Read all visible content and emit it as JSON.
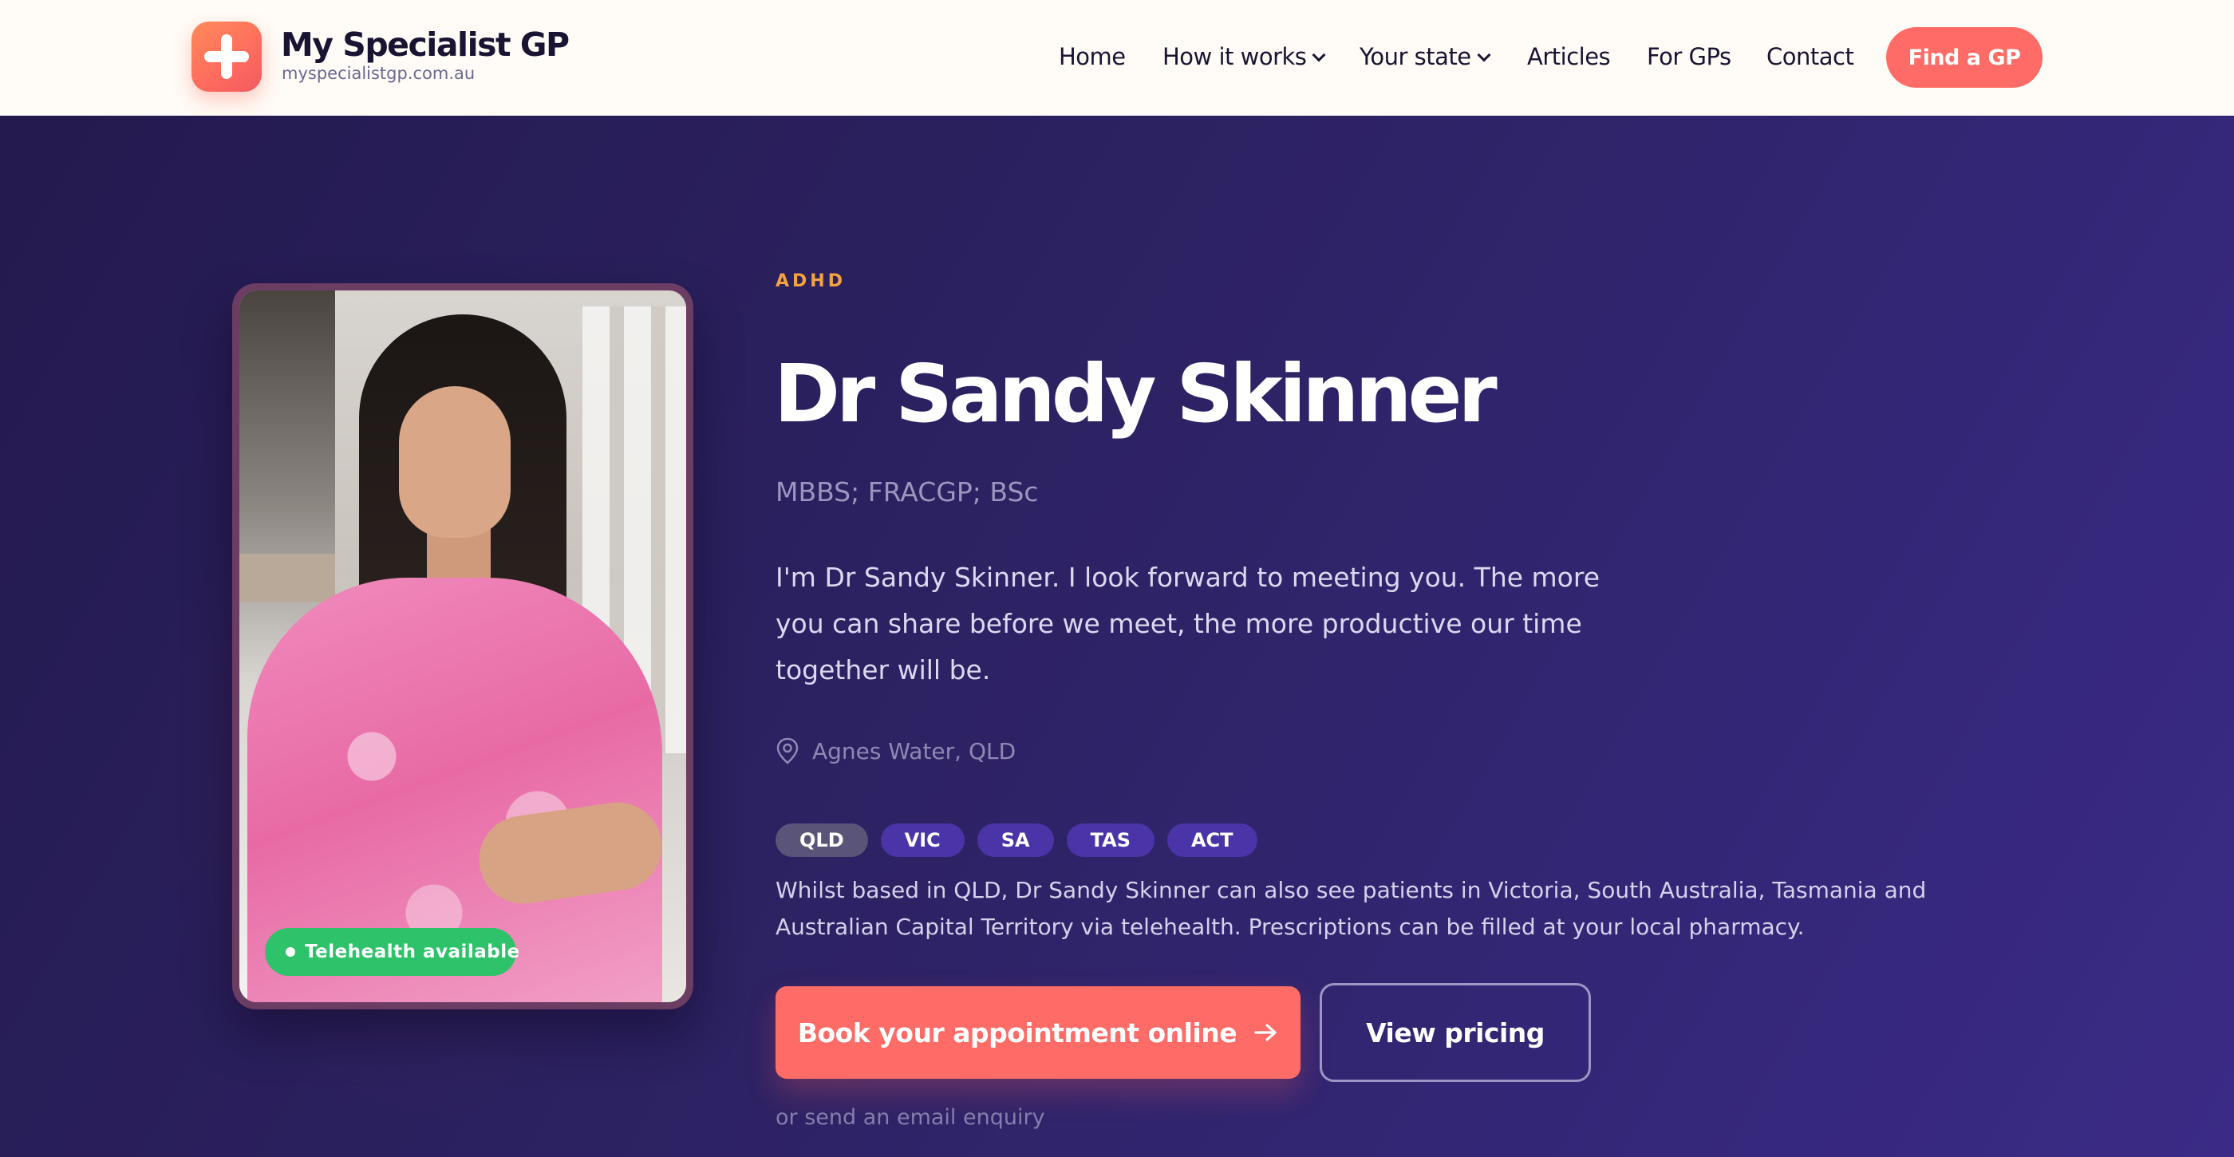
{
  "header": {
    "logo_title": "My Specialist GP",
    "logo_subtitle": "myspecialistgp.com.au",
    "logo_icon": "plus-cross-icon",
    "nav": {
      "home": "Home",
      "how_it_works": "How it works",
      "your_state": "Your state",
      "articles": "Articles",
      "for_gps": "For GPs",
      "contact": "Contact"
    },
    "cta": "Find a GP"
  },
  "profile": {
    "eyebrow": "ADHD",
    "name": "Dr Sandy Skinner",
    "credentials": "MBBS; FRACGP; BSc",
    "bio": "I'm Dr Sandy Skinner. I look forward to meeting you. The more you can share before we meet, the more productive our time together will be.",
    "location": "Agnes Water, QLD",
    "telehealth_badge": "Telehealth available",
    "states": [
      "QLD",
      "VIC",
      "SA",
      "TAS",
      "ACT"
    ],
    "coverage": "Whilst based in QLD, Dr Sandy Skinner can also see patients in Victoria, South Australia, Tasmania and Australian Capital Territory via telehealth. Prescriptions can be filled at your local pharmacy.",
    "book_button": "Book your appointment online",
    "pricing_button": "View pricing",
    "email_link": "or send an email enquiry"
  },
  "colors": {
    "accent": "#ff6b66",
    "eyebrow": "#f5a340",
    "telehealth": "#2ec26a",
    "hero_bg": "#2d2263"
  }
}
